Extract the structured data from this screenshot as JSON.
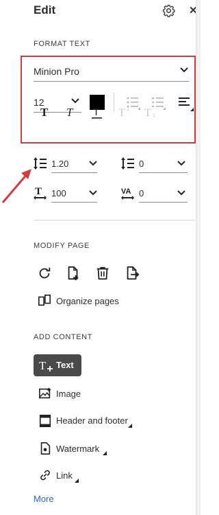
{
  "header": {
    "title": "Edit"
  },
  "format_text": {
    "section_label": "FORMAT TEXT",
    "font_family": "Minion Pro",
    "font_size": "12",
    "color": "#000000",
    "line_spacing": "1.20",
    "paragraph_spacing": "0",
    "horizontal_scale": "100",
    "char_spacing": "0"
  },
  "modify_page": {
    "section_label": "MODIFY PAGE",
    "organize_label": "Organize pages"
  },
  "add_content": {
    "section_label": "ADD CONTENT",
    "items": [
      "Text",
      "Image",
      "Header and footer",
      "Watermark",
      "Link"
    ],
    "more_label": "More"
  },
  "colors": {
    "highlight": "#d9383f",
    "active_button": "#4a4a4a",
    "link": "#2c68c4"
  }
}
